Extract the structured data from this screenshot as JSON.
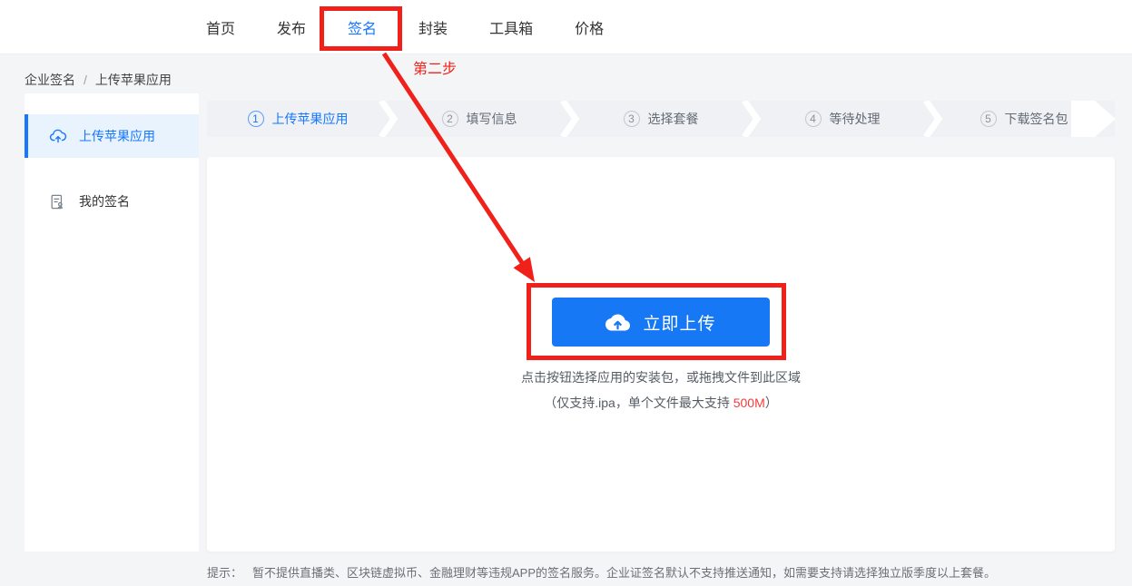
{
  "nav": {
    "items": [
      {
        "label": "首页"
      },
      {
        "label": "发布"
      },
      {
        "label": "签名"
      },
      {
        "label": "封装"
      },
      {
        "label": "工具箱"
      },
      {
        "label": "价格"
      }
    ],
    "active": "签名"
  },
  "breadcrumb": {
    "section": "企业签名",
    "separator": "/",
    "page": "上传苹果应用"
  },
  "sidebar": {
    "items": [
      {
        "label": "上传苹果应用",
        "icon": "cloud-upload-icon",
        "active": true
      },
      {
        "label": "我的签名",
        "icon": "signature-doc-icon",
        "active": false
      }
    ]
  },
  "steps": {
    "items": [
      {
        "num": "1",
        "label": "上传苹果应用",
        "active": true
      },
      {
        "num": "2",
        "label": "填写信息",
        "active": false
      },
      {
        "num": "3",
        "label": "选择套餐",
        "active": false
      },
      {
        "num": "4",
        "label": "等待处理",
        "active": false
      },
      {
        "num": "5",
        "label": "下载签名包",
        "active": false
      }
    ]
  },
  "upload": {
    "button_label": "立即上传",
    "button_icon": "cloud-icon",
    "hint_line1": "点击按钮选择应用的安装包，或拖拽文件到此区域",
    "hint_line2_prefix": "（仅支持.ipa，单个文件最大支持 ",
    "hint_line2_highlight": "500M",
    "hint_line2_suffix": "）"
  },
  "footer": {
    "prefix": "提示：",
    "text": "暂不提供直播类、区块链虚拟币、金融理财等违规APP的签名服务。企业证签名默认不支持推送通知，如需要支持请选择独立版季度以上套餐。"
  },
  "annotations": {
    "step_label": "第二步"
  },
  "colors": {
    "accent_blue": "#1677ff",
    "button_blue": "#1778f5",
    "annotation_red": "#f0201a",
    "highlight_red": "#f23c3c",
    "selected_item_bg": "#e9f3fe",
    "steps_bar_bg": "#eff1f5"
  }
}
